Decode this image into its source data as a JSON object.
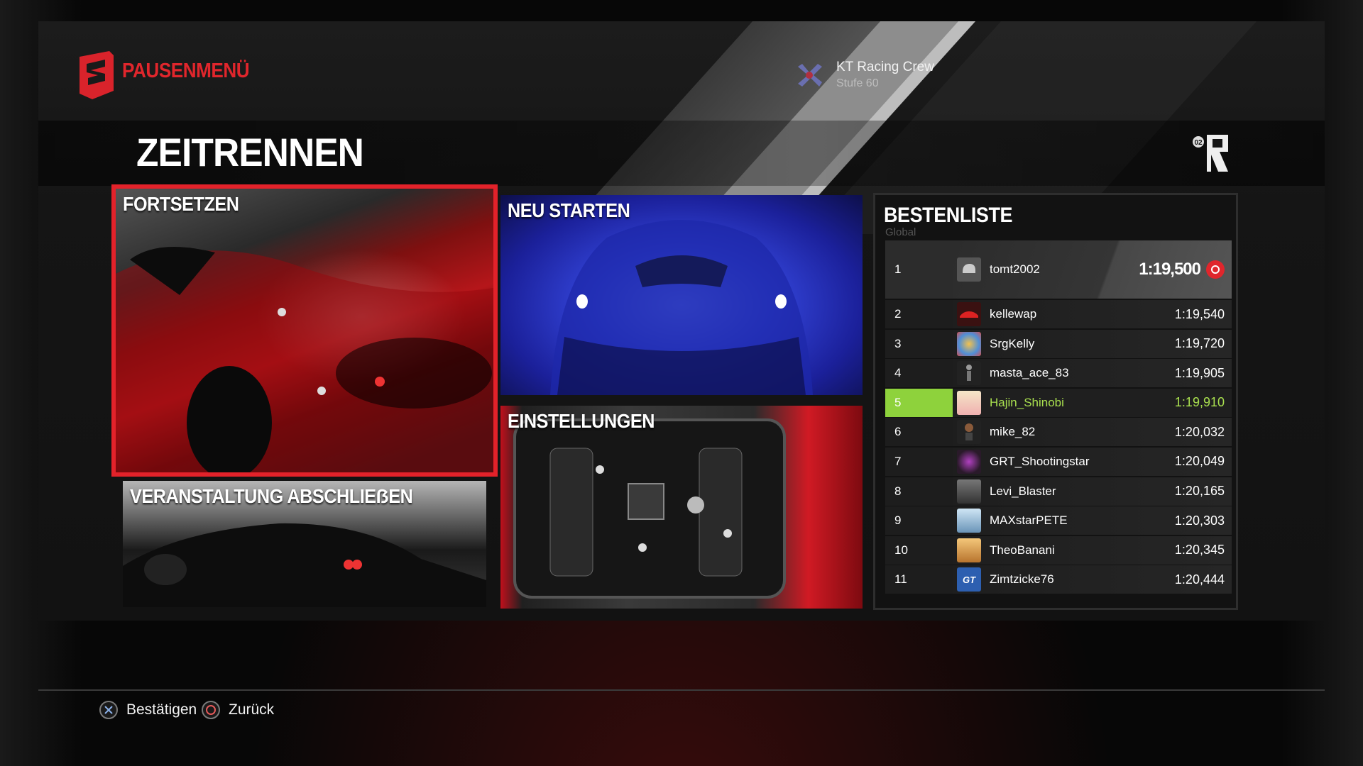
{
  "header": {
    "menu_title": "PAUSENMENÜ",
    "crew_name": "KT Racing Crew",
    "crew_level": "Stufe 60",
    "page_title": "ZEITRENNEN",
    "accent_color": "#e0262c"
  },
  "tiles": {
    "continue": "FORTSETZEN",
    "restart": "NEU STARTEN",
    "finish": "VERANSTALTUNG ABSCHLIEẞEN",
    "settings": "EINSTELLUNGEN",
    "selected": "continue"
  },
  "leaderboard": {
    "title": "BESTENLISTE",
    "scope": "Global",
    "highlight_color": "#8ed23c",
    "rows": [
      {
        "rank": "1",
        "name": "tomt2002",
        "time": "1:19,500"
      },
      {
        "rank": "2",
        "name": "kellewap",
        "time": "1:19,540"
      },
      {
        "rank": "3",
        "name": "SrgKelly",
        "time": "1:19,720"
      },
      {
        "rank": "4",
        "name": "masta_ace_83",
        "time": "1:19,905"
      },
      {
        "rank": "5",
        "name": "Hajin_Shinobi",
        "time": "1:19,910"
      },
      {
        "rank": "6",
        "name": "mike_82",
        "time": "1:20,032"
      },
      {
        "rank": "7",
        "name": "GRT_Shootingstar",
        "time": "1:20,049"
      },
      {
        "rank": "8",
        "name": "Levi_Blaster",
        "time": "1:20,165"
      },
      {
        "rank": "9",
        "name": "MAXstarPETE",
        "time": "1:20,303"
      },
      {
        "rank": "10",
        "name": "TheoBanani",
        "time": "1:20,345"
      },
      {
        "rank": "11",
        "name": "Zimtzicke76",
        "time": "1:20,444"
      }
    ]
  },
  "footer": {
    "confirm_label": "Bestätigen",
    "back_label": "Zurück",
    "confirm_icon": "cross-button-icon",
    "back_icon": "circle-button-icon"
  }
}
